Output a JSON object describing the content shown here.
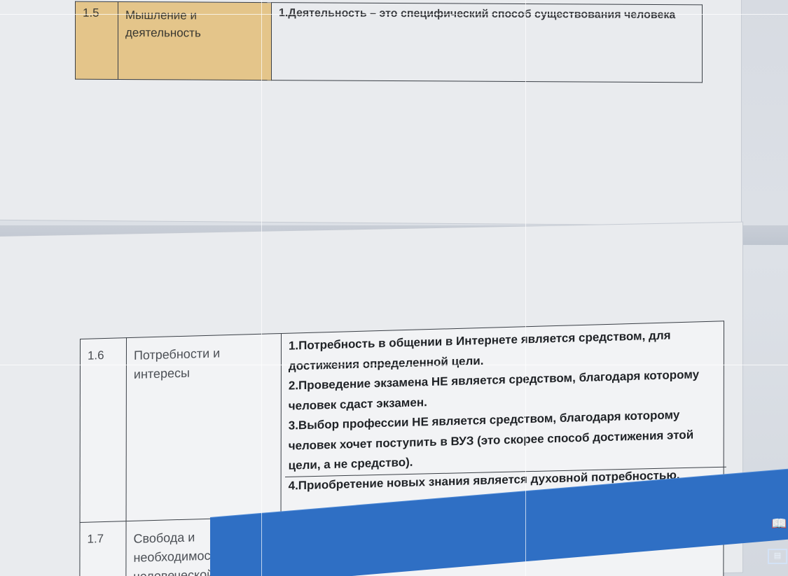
{
  "document": {
    "table_top": {
      "number": "1.5",
      "title_lines": [
        "Мышление и",
        "деятельность"
      ],
      "content": "1.Деятельность – это специфический способ существования человека"
    },
    "table_bottom": {
      "row1": {
        "number": "1.6",
        "title_lines": [
          "Потребности и",
          "интересы"
        ],
        "content_lines": [
          "1.Потребность в общении в Интернете является средством, для",
          "достижения определенной цели.",
          "2.Проведение экзамена НЕ является средством, благодаря которому",
          "человек сдаст экзамен.",
          "3.Выбор профессии НЕ является средством, благодаря которому",
          "человек хочет поступить в ВУЗ (это скорее способ достижения этой",
          "цели, а не средство).",
          "4.Приобретение новых знания является духовной потребностью."
        ]
      },
      "row2": {
        "number": "1.7",
        "title_lines": [
          "Свобода и",
          "необходимость в",
          "человеческой"
        ]
      }
    }
  },
  "statusbar": {
    "icons": [
      "read-mode-icon",
      "print-layout-icon"
    ],
    "accent_color": "#2f6fc4"
  }
}
